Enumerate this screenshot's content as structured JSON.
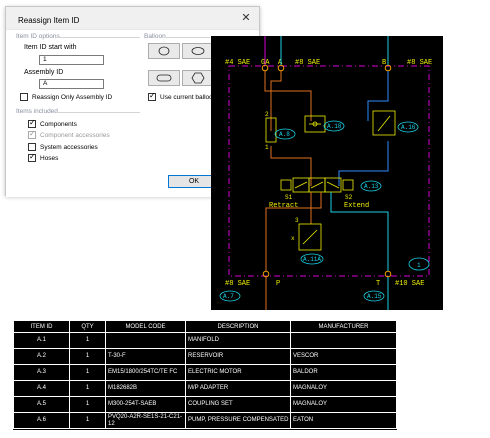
{
  "dialog": {
    "title": "Reassign Item ID",
    "item_options_label": "Item ID options",
    "start_with_label": "Item ID start with",
    "start_with_value": "1",
    "assembly_label": "Assembly ID",
    "assembly_value": "A",
    "reassign_only_label": "Reassign Only Assembly ID",
    "balloon_label": "Balloon",
    "use_current_label": "Use current balloon t",
    "items_included_label": "Items included",
    "components_label": "Components",
    "component_accessories_label": "Component accessories",
    "system_accessories_label": "System accessories",
    "hoses_label": "Hoses",
    "ok_label": "OK"
  },
  "schematic": {
    "port_tl": "#4 SAE",
    "port_ga": "GA",
    "port_a": "A",
    "port_tr_label": "#8 SAE",
    "port_b": "B",
    "port_br": "#8 SAE",
    "tag_a8": "A.8",
    "tag_a18": "A.18",
    "tag_a16": "A.16",
    "tag_a13": "A.13",
    "label_s1": "S1",
    "label_s2": "S2",
    "label_retract": "Retract",
    "label_extend": "Extend",
    "tag_a11a": "A.11A",
    "tag_1": "1",
    "port_bl": "#8 SAE",
    "port_p": "P",
    "port_t": "T",
    "port_t_label": "#10 SAE",
    "tag_a7": "A.7",
    "tag_a15": "A.15",
    "num_2": "2",
    "num_3": "3",
    "num_1": "1",
    "num_x": "x"
  },
  "table": {
    "headers": [
      "ITEM ID",
      "QTY",
      "MODEL CODE",
      "DESCRIPTION",
      "MANUFACTURER"
    ],
    "rows": [
      [
        "A.1",
        "1",
        "",
        "MANIFOLD",
        ""
      ],
      [
        "A.2",
        "1",
        "T-30-F",
        "RESERVOIR",
        "VESCOR"
      ],
      [
        "A.3",
        "1",
        "EM15/1800/254TC/TE FC",
        "ELECTRIC MOTOR",
        "BALDOR"
      ],
      [
        "A.4",
        "1",
        "M182682B",
        "M/P ADAPTER",
        "MAGNALOY"
      ],
      [
        "A.5",
        "1",
        "M300-254T-SAEB",
        "COUPLING SET",
        "MAGNALOY"
      ],
      [
        "A.6",
        "1",
        "PVQ20-A2R-SE1S-21-C21-12",
        "PUMP, PRESSURE COMPENSATED",
        "EATON"
      ]
    ]
  },
  "colors": {
    "magenta": "#d400d4",
    "yellow": "#f0f000",
    "cyan": "#1ad1e8",
    "orange": "#e07020",
    "blue": "#2f8cff"
  }
}
